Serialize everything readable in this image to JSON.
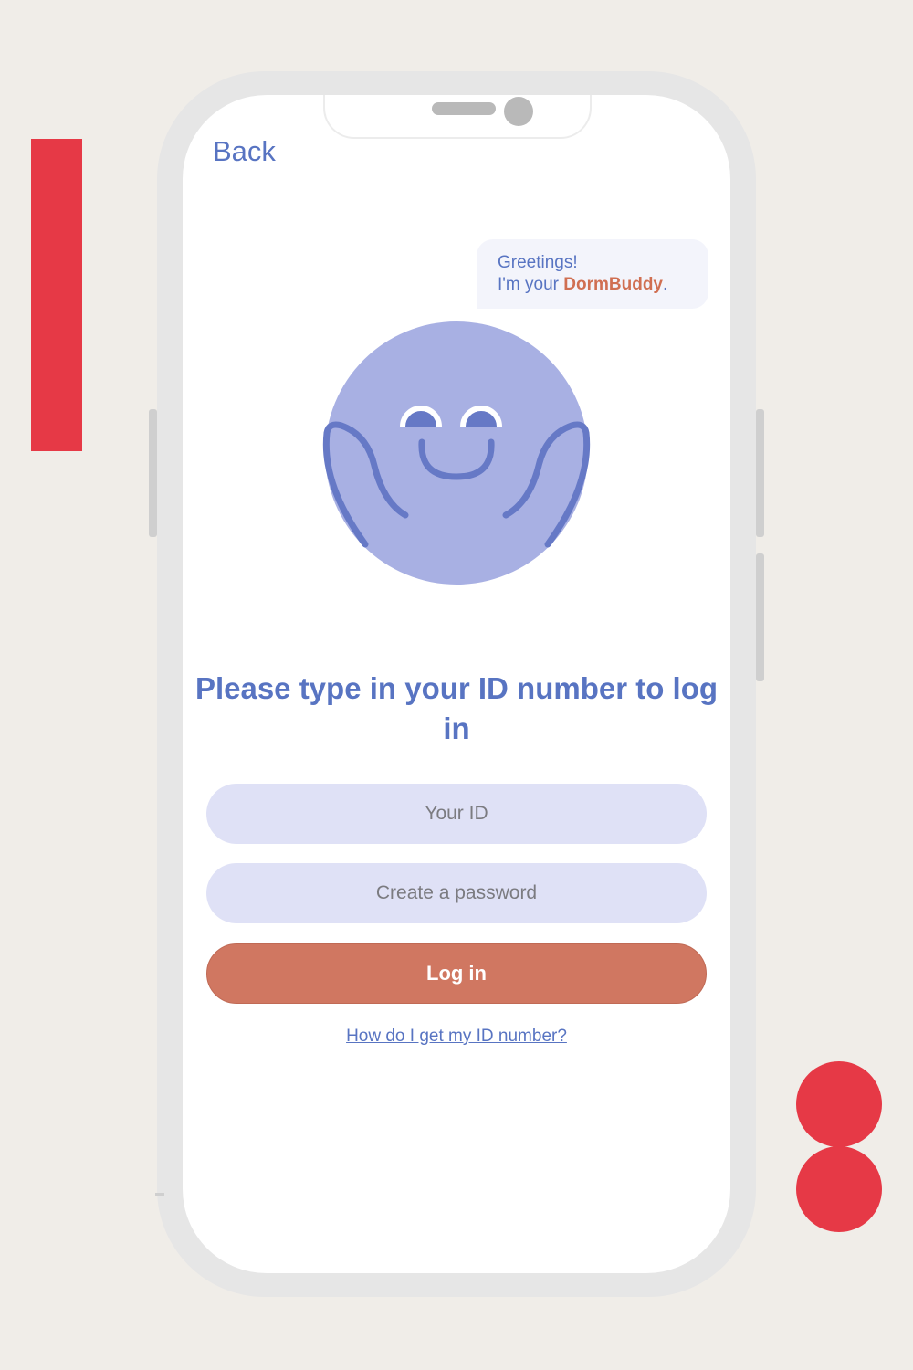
{
  "nav": {
    "back_label": "Back"
  },
  "bubble": {
    "line1": "Greetings!",
    "line2_prefix": "I'm your ",
    "brand": "DormBuddy",
    "line2_suffix": "."
  },
  "headline": "Please type in your ID number to log in",
  "form": {
    "id_placeholder": "Your ID",
    "password_placeholder": "Create a password",
    "login_label": "Log in",
    "help_link": "How  do I get my ID number?"
  },
  "colors": {
    "primary_text": "#5874c2",
    "accent": "#d07761",
    "field_bg": "#dfe1f6",
    "mascot_fill": "#a8b0e3",
    "decor_red": "#e63946"
  },
  "icons": {
    "mascot": "smiling-blob-mascot"
  }
}
